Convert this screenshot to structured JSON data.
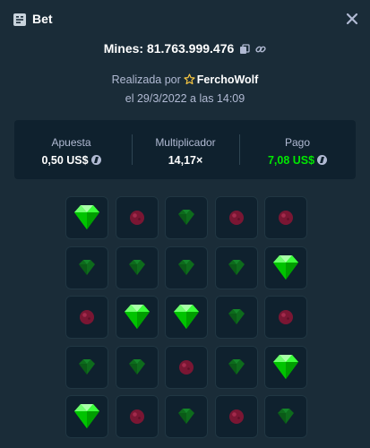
{
  "header": {
    "title": "Bet",
    "title_icon": "bet-slip-icon",
    "close_icon": "close-icon"
  },
  "bet": {
    "mines_label": "Mines: 81.763.999.476",
    "copy_icon": "copy-icon",
    "link_icon": "link-icon",
    "made_by_prefix": "Realizada por",
    "user": "FerchoWolf",
    "date_text": "el 29/3/2022 a las 14:09"
  },
  "stats": {
    "bet_label": "Apuesta",
    "bet_value": "0,50 US$",
    "multiplier_label": "Multiplicador",
    "multiplier_value": "14,17×",
    "payout_label": "Pago",
    "payout_value": "7,08 US$"
  },
  "grid": {
    "rows": 5,
    "cols": 5,
    "legend": {
      "G": "gem-revealed",
      "g": "gem-unrevealed",
      "m": "mine-unrevealed"
    },
    "tiles": [
      "G",
      "m",
      "g",
      "m",
      "m",
      "g",
      "g",
      "g",
      "g",
      "G",
      "m",
      "G",
      "G",
      "g",
      "m",
      "g",
      "g",
      "m",
      "g",
      "G",
      "G",
      "m",
      "g",
      "m",
      "g"
    ]
  },
  "colors": {
    "background": "#1a2c38",
    "panel": "#0f212e",
    "accent_green": "#00e701",
    "muted_text": "#b1bad3",
    "mine": "#8e1b3c"
  }
}
